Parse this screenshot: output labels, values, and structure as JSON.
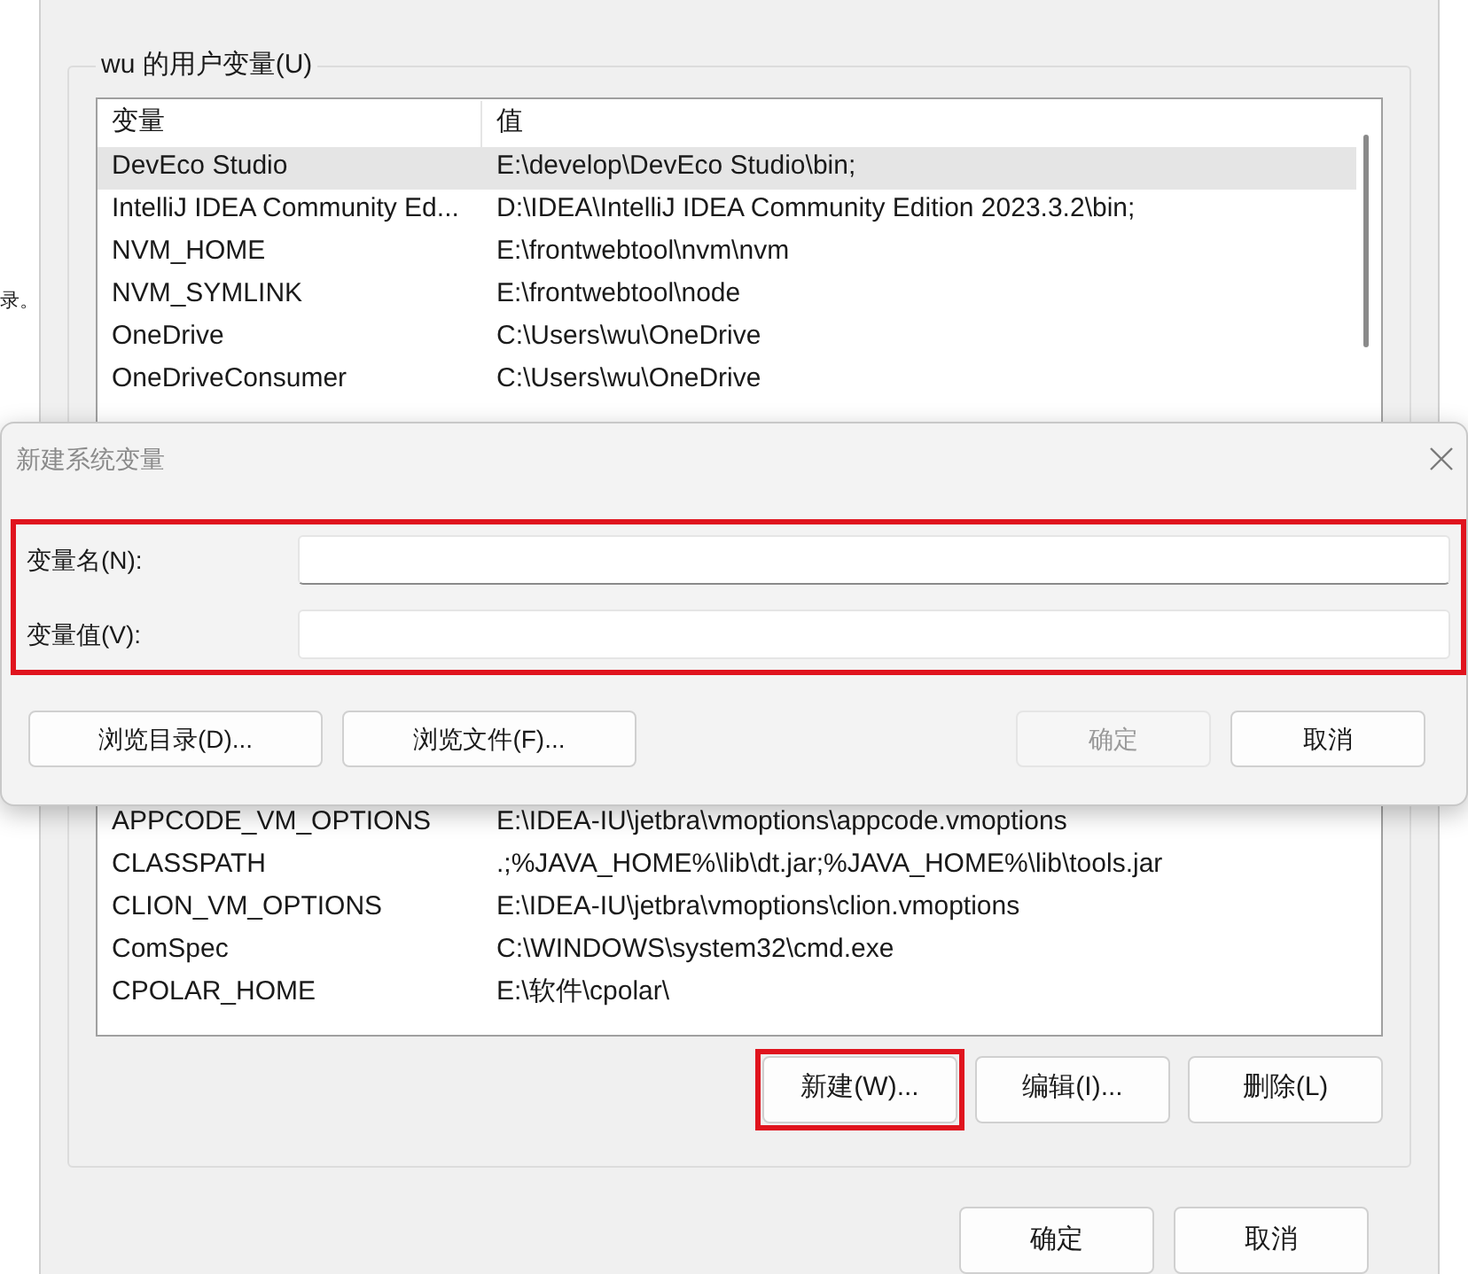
{
  "background_text": "录。",
  "window": {
    "group_title": "wu 的用户变量(U)",
    "table": {
      "columns": [
        "变量",
        "值"
      ],
      "rows_top": [
        {
          "name": "DevEco Studio",
          "value": "E:\\develop\\DevEco Studio\\bin;",
          "selected": true
        },
        {
          "name": "IntelliJ IDEA Community Ed...",
          "value": "D:\\IDEA\\IntelliJ IDEA Community Edition 2023.3.2\\bin;",
          "selected": false
        },
        {
          "name": "NVM_HOME",
          "value": "E:\\frontwebtool\\nvm\\nvm",
          "selected": false
        },
        {
          "name": "NVM_SYMLINK",
          "value": "E:\\frontwebtool\\node",
          "selected": false
        },
        {
          "name": "OneDrive",
          "value": "C:\\Users\\wu\\OneDrive",
          "selected": false
        },
        {
          "name": "OneDriveConsumer",
          "value": "C:\\Users\\wu\\OneDrive",
          "selected": false
        }
      ],
      "rows_bottom": [
        {
          "name": "APPCODE_VM_OPTIONS",
          "value": "E:\\IDEA-IU\\jetbra\\vmoptions\\appcode.vmoptions",
          "selected": false
        },
        {
          "name": "CLASSPATH",
          "value": ".;%JAVA_HOME%\\lib\\dt.jar;%JAVA_HOME%\\lib\\tools.jar",
          "selected": false
        },
        {
          "name": "CLION_VM_OPTIONS",
          "value": "E:\\IDEA-IU\\jetbra\\vmoptions\\clion.vmoptions",
          "selected": false
        },
        {
          "name": "ComSpec",
          "value": "C:\\WINDOWS\\system32\\cmd.exe",
          "selected": false
        },
        {
          "name": "CPOLAR_HOME",
          "value": "E:\\软件\\cpolar\\",
          "selected": false
        }
      ]
    },
    "buttons": [
      {
        "label": "新建(W)...",
        "highlighted": true
      },
      {
        "label": "编辑(I)...",
        "highlighted": false
      },
      {
        "label": "删除(L)",
        "highlighted": false
      }
    ],
    "footer_buttons": [
      {
        "label": "确定"
      },
      {
        "label": "取消"
      }
    ]
  },
  "dialog": {
    "title": "新建系统变量",
    "fields_highlighted": true,
    "fields": [
      {
        "label": "变量名(N):",
        "focused": true
      },
      {
        "label": "变量值(V):",
        "focused": false
      }
    ],
    "left_buttons": [
      {
        "label": "浏览目录(D)..."
      },
      {
        "label": "浏览文件(F)..."
      }
    ],
    "right_buttons": [
      {
        "label": "确定",
        "disabled": true
      },
      {
        "label": "取消",
        "disabled": false
      }
    ]
  }
}
